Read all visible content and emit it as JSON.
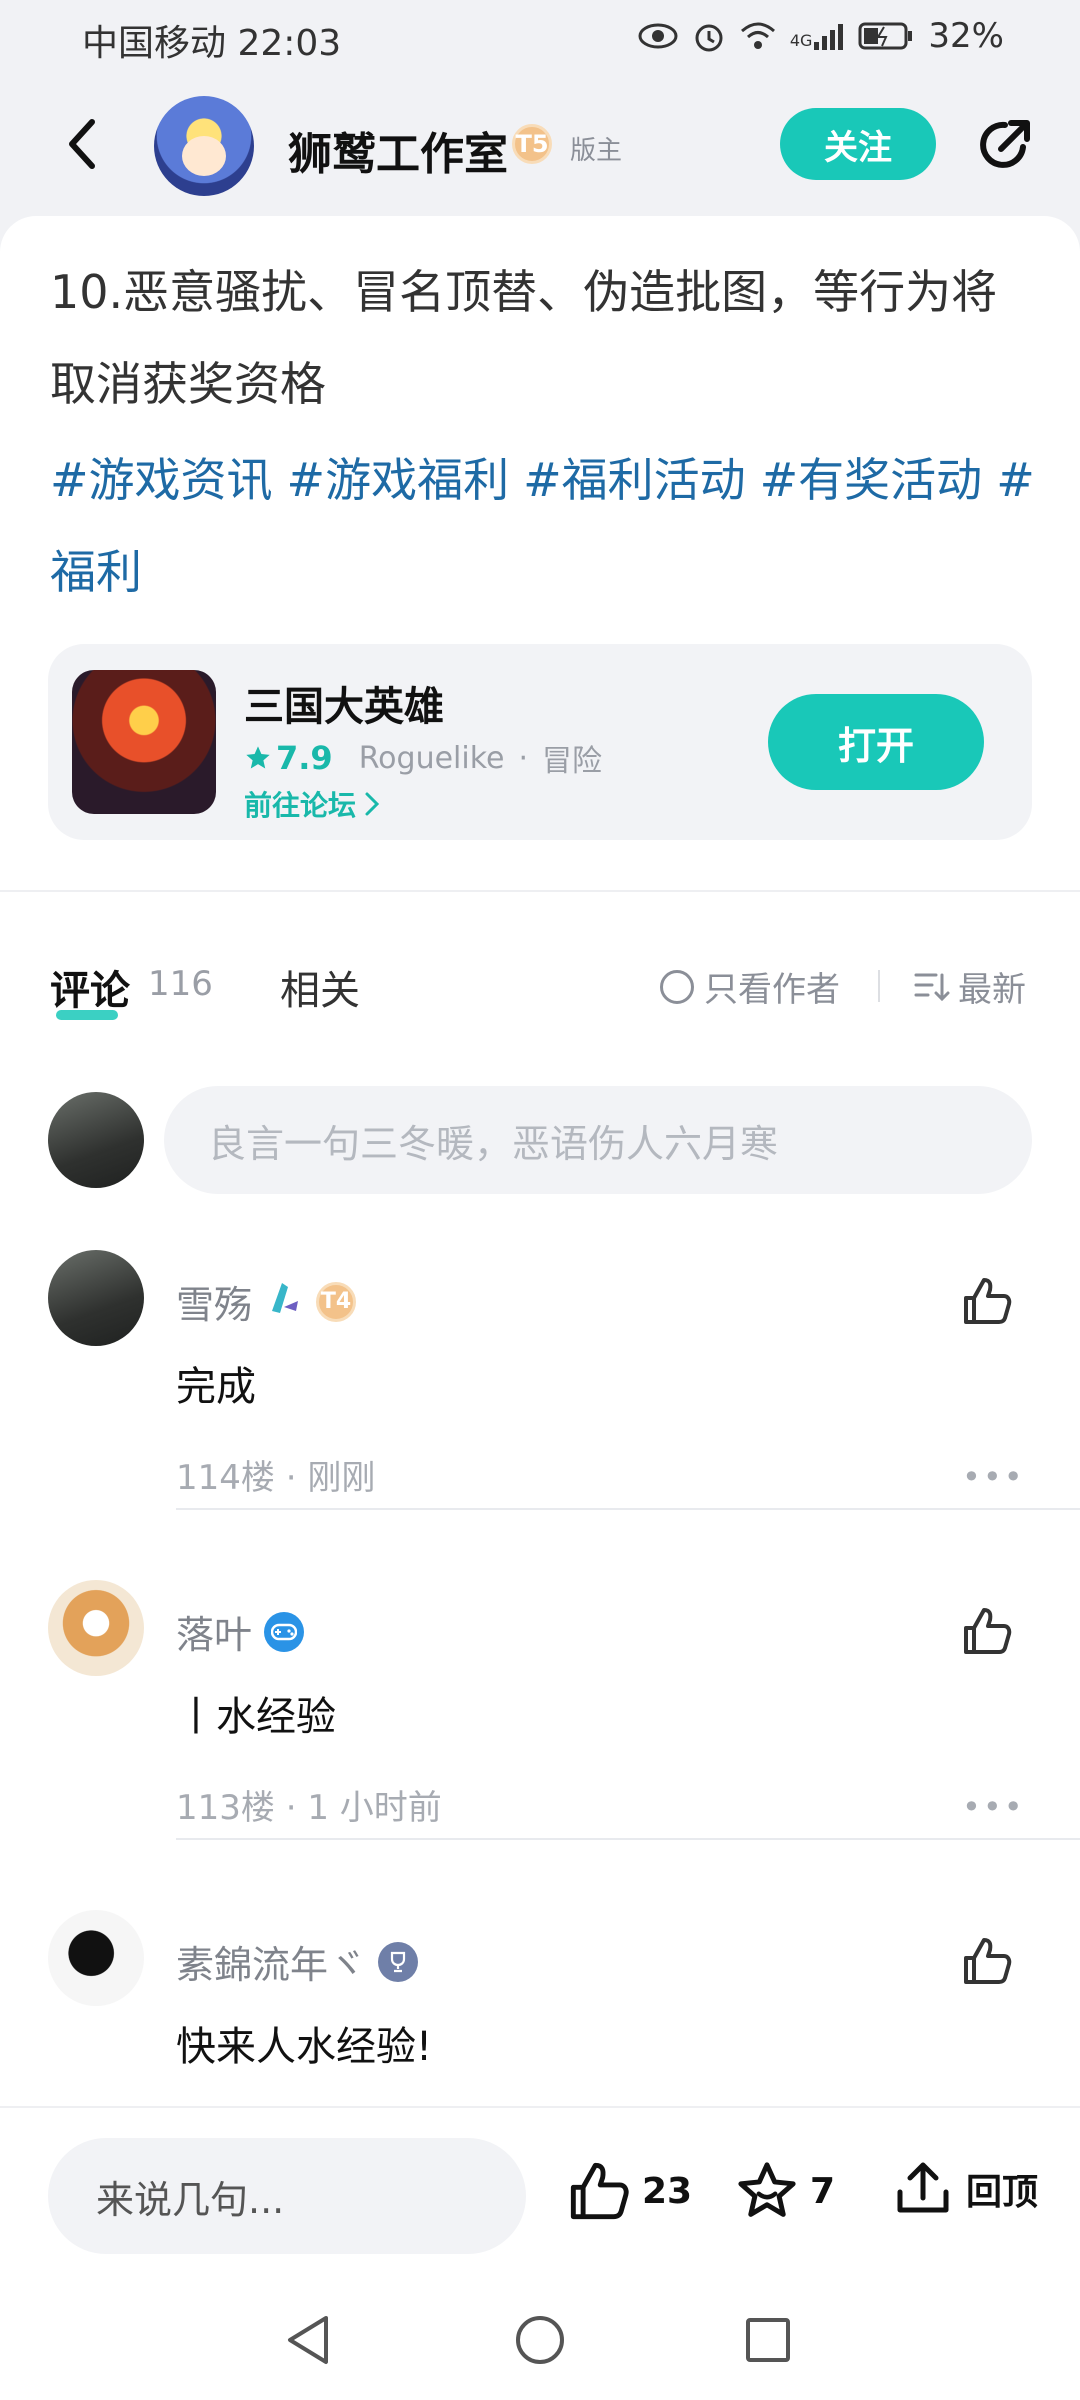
{
  "status_bar": {
    "carrier_time": "中国移动 22:03",
    "network": "4G",
    "battery": "32%"
  },
  "header": {
    "name": "狮鹫工作室",
    "level": "T5",
    "role": "版主",
    "follow_label": "关注"
  },
  "post": {
    "text": "10.恶意骚扰、冒名顶替、伪造批图，等行为将取消获奖资格",
    "hashtags": [
      "#游戏资讯",
      "#游戏福利",
      "#福利活动",
      "#有奖活动",
      "#福利"
    ]
  },
  "game": {
    "name": "三国大英雄",
    "rating": "7.9",
    "genre": "Roguelike",
    "category": "冒险",
    "forum_link": "前往论坛",
    "open_label": "打开"
  },
  "tabs": {
    "comments_label": "评论",
    "comments_count": "116",
    "related_label": "相关",
    "author_only_label": "只看作者",
    "sort_label": "最新"
  },
  "comment_input": {
    "placeholder": "良言一句三冬暖，恶语伤人六月寒"
  },
  "comments": [
    {
      "name": "雪殇",
      "badge": "T4",
      "body": "完成",
      "meta": "114楼 · 刚刚"
    },
    {
      "name": "落叶",
      "body": "丨水经验",
      "meta": "113楼 · 1 小时前"
    },
    {
      "name": "素錦流年ヾ",
      "body": "快来人水经验!"
    }
  ],
  "bottom_bar": {
    "input_placeholder": "来说几句...",
    "like_count": "23",
    "star_count": "7",
    "top_label": "回顶"
  },
  "colors": {
    "accent": "#19c8b8",
    "hashtag": "#1e6aa5",
    "background": "#f1f2f5"
  }
}
